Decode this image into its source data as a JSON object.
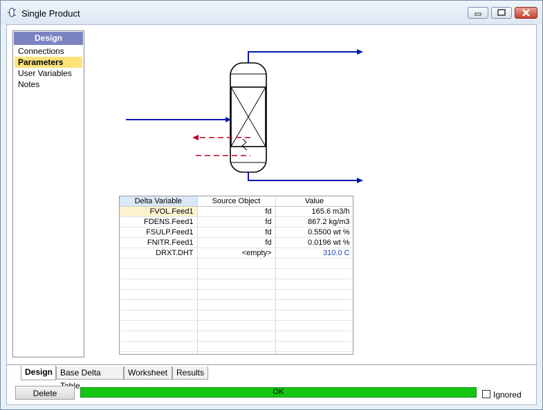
{
  "window": {
    "title": "Single Product"
  },
  "sidebar": {
    "header": "Design",
    "items": [
      {
        "label": "Connections",
        "selected": false
      },
      {
        "label": "Parameters",
        "selected": true
      },
      {
        "label": "User Variables",
        "selected": false
      },
      {
        "label": "Notes",
        "selected": false
      }
    ]
  },
  "table": {
    "headers": [
      "Delta Variable",
      "Source Object",
      "Value"
    ],
    "rows": [
      {
        "variable": "FVOL.Feed1",
        "source": "fd",
        "value": "165.6 m3/h"
      },
      {
        "variable": "FDENS.Feed1",
        "source": "fd",
        "value": "867.2 kg/m3"
      },
      {
        "variable": "FSULP.Feed1",
        "source": "fd",
        "value": "0.5500 wt %"
      },
      {
        "variable": "FNITR.Feed1",
        "source": "fd",
        "value": "0.0196 wt %"
      },
      {
        "variable": "DRXT.DHT",
        "source": "<empty>",
        "value": "310.0 C"
      }
    ]
  },
  "tabs": [
    "Design",
    "Base Delta Table",
    "Worksheet",
    "Results"
  ],
  "footer": {
    "delete_label": "Delete",
    "status": "OK",
    "ignored_label": "Ignored"
  },
  "colors": {
    "stream": "#0018b0",
    "energy": "#c00020",
    "status_ok": "#17c515",
    "selection": "#fbe37a"
  }
}
